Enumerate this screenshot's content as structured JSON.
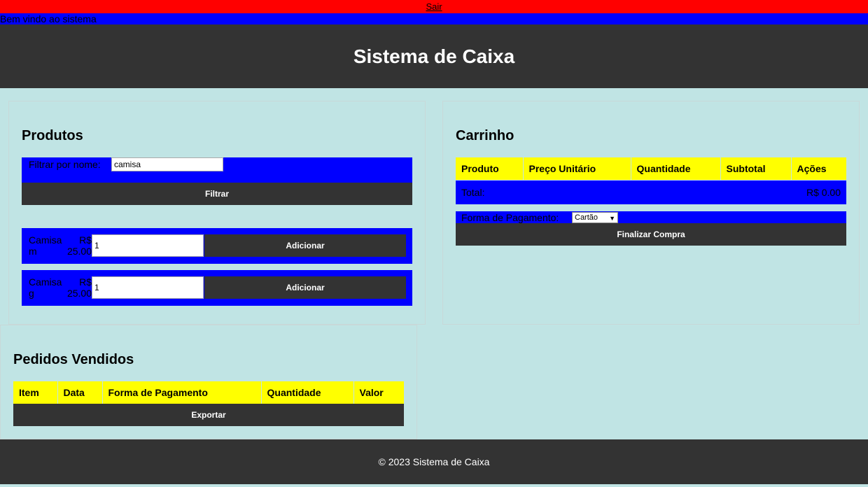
{
  "topbar": {
    "logout_label": "Sair"
  },
  "welcome": {
    "text": "Bem vindo ao sistema"
  },
  "header": {
    "title": "Sistema de Caixa"
  },
  "produtos": {
    "title": "Produtos",
    "filter_label": "Filtrar por nome:",
    "filter_value": "camisa",
    "filter_button": "Filtrar",
    "items": [
      {
        "name": "Camisa m",
        "price": "R$ 25.00",
        "quantity": "1",
        "add_label": "Adicionar"
      },
      {
        "name": "Camisa g",
        "price": "R$ 25.00",
        "quantity": "1",
        "add_label": "Adicionar"
      }
    ]
  },
  "carrinho": {
    "title": "Carrinho",
    "columns": [
      "Produto",
      "Preço Unitário",
      "Quantidade",
      "Subtotal",
      "Ações"
    ],
    "total_label": "Total:",
    "total_value": "R$ 0.00",
    "payment_label": "Forma de Pagamento:",
    "payment_selected": "Cartão",
    "finish_button": "Finalizar Compra"
  },
  "pedidos": {
    "title": "Pedidos Vendidos",
    "columns": [
      "Item",
      "Data",
      "Forma de Pagamento",
      "Quantidade",
      "Valor"
    ],
    "export_button": "Exportar"
  },
  "footer": {
    "text": "© 2023 Sistema de Caixa"
  },
  "colors": {
    "topbar": "#ff0000",
    "highlight": "#0000ff",
    "table_header": "#ffff00",
    "dark": "#333333",
    "background": "#c0e4e4"
  }
}
